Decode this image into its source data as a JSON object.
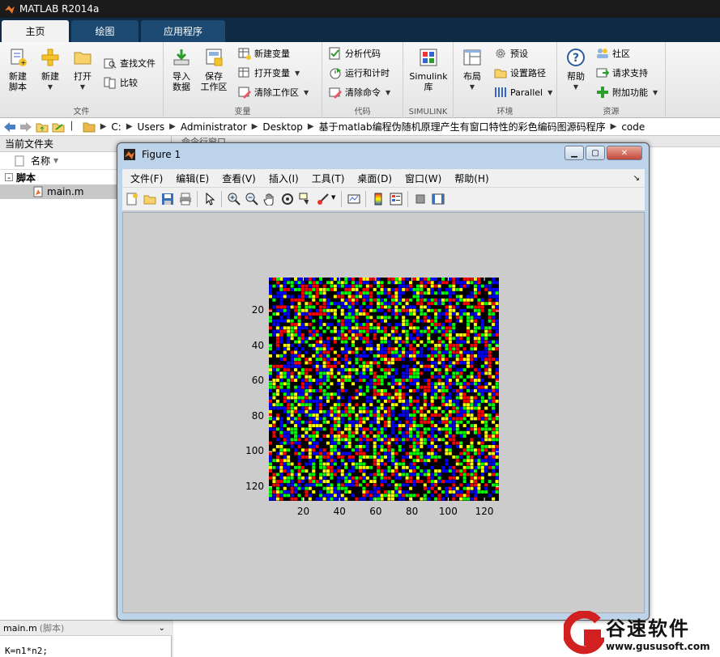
{
  "app": {
    "title": "MATLAB R2014a"
  },
  "tabs": [
    {
      "label": "主页",
      "active": true
    },
    {
      "label": "绘图",
      "active": false
    },
    {
      "label": "应用程序",
      "active": false
    }
  ],
  "ribbon": {
    "file": {
      "group_label": "文件",
      "new_script": "新建\n脚本",
      "new": "新建",
      "open": "打开",
      "find_files": "查找文件",
      "compare": "比较"
    },
    "variable": {
      "group_label": "变量",
      "import_data": "导入\n数据",
      "save_workspace": "保存\n工作区",
      "new_variable": "新建变量",
      "open_variable": "打开变量",
      "clear_workspace": "清除工作区"
    },
    "code": {
      "group_label": "代码",
      "analyze_code": "分析代码",
      "run_and_time": "运行和计时",
      "clear_commands": "清除命令"
    },
    "simulink": {
      "group_label": "SIMULINK",
      "label": "Simulink\n库"
    },
    "environment": {
      "group_label": "环境",
      "layout": "布局",
      "preferences": "预设",
      "set_path": "设置路径",
      "parallel": "Parallel"
    },
    "resources": {
      "group_label": "资源",
      "help": "帮助",
      "community": "社区",
      "request_support": "请求支持",
      "add_ons": "附加功能"
    }
  },
  "address": {
    "crumbs": [
      "C:",
      "Users",
      "Administrator",
      "Desktop",
      "基于matlab编程伪随机原理产生有窗口特性的彩色编码图源码程序",
      "code"
    ]
  },
  "left_panel": {
    "title": "当前文件夹",
    "column": "名称",
    "group": "脚本",
    "file": "main.m",
    "detail_name": "main.m",
    "detail_type": "(脚本)",
    "code_line": "K=n1*n2;"
  },
  "cmd_window": {
    "title": "命令行窗口"
  },
  "figure": {
    "title": "Figure 1",
    "menu": [
      "文件(F)",
      "编辑(E)",
      "查看(V)",
      "插入(I)",
      "工具(T)",
      "桌面(D)",
      "窗口(W)",
      "帮助(H)"
    ],
    "colors": [
      "#ff0000",
      "#00ff00",
      "#0000ff",
      "#ffff00",
      "#000000"
    ]
  },
  "chart_data": {
    "type": "heatmap",
    "grid_size": [
      128,
      128
    ],
    "xticks": [
      20,
      40,
      60,
      80,
      100,
      120
    ],
    "yticks": [
      20,
      40,
      60,
      80,
      100,
      120
    ],
    "xlim": [
      1,
      128
    ],
    "ylim": [
      1,
      128
    ],
    "palette": [
      "#000000",
      "#ff0000",
      "#00ff00",
      "#0000ff",
      "#ffff00"
    ]
  },
  "watermark": {
    "brand": "谷速软件",
    "url": "www.gususoft.com"
  }
}
